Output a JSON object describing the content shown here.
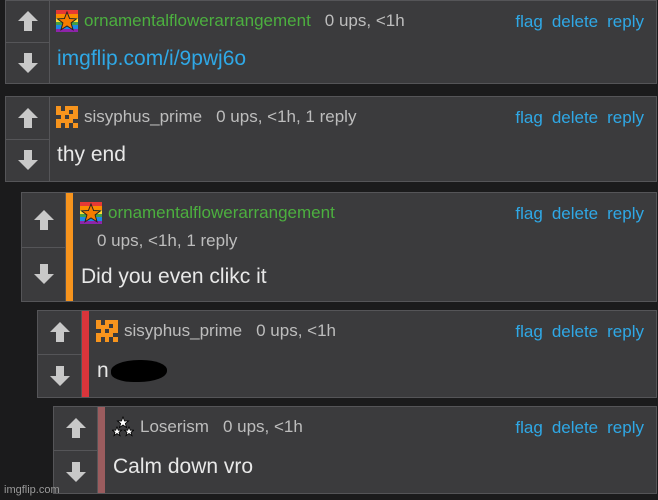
{
  "colors": {
    "username_green": "#4caf3f",
    "username_gray": "#bdbdbd",
    "link_blue": "#2fa8e6",
    "accent_orange": "#f7941d",
    "accent_red": "#d9353b",
    "accent_mauve": "#9b5c5e"
  },
  "actions": {
    "flag": "flag",
    "delete": "delete",
    "reply": "reply"
  },
  "comments": [
    {
      "username": "ornamentalflowerarrangement",
      "stats": "0 ups, <1h",
      "body": "imgflip.com/i/9pwj6o",
      "body_is_link": true,
      "avatar": "rainbow-star-icon"
    },
    {
      "username": "sisyphus_prime",
      "stats": "0 ups, <1h, 1 reply",
      "body": "thy end",
      "avatar": "orange-pixel-icon"
    },
    {
      "username": "ornamentalflowerarrangement",
      "stats": "0 ups, <1h, 1 reply",
      "body": "Did you even clikc it",
      "avatar": "rainbow-star-icon"
    },
    {
      "username": "sisyphus_prime",
      "stats": "0 ups, <1h",
      "body": "n",
      "body_redacted": true,
      "avatar": "orange-pixel-icon"
    },
    {
      "username": "Loserism",
      "stats": "0 ups, <1h",
      "body": "Calm down vro",
      "avatar": "triple-star-icon"
    }
  ],
  "watermark": "imgflip.com"
}
